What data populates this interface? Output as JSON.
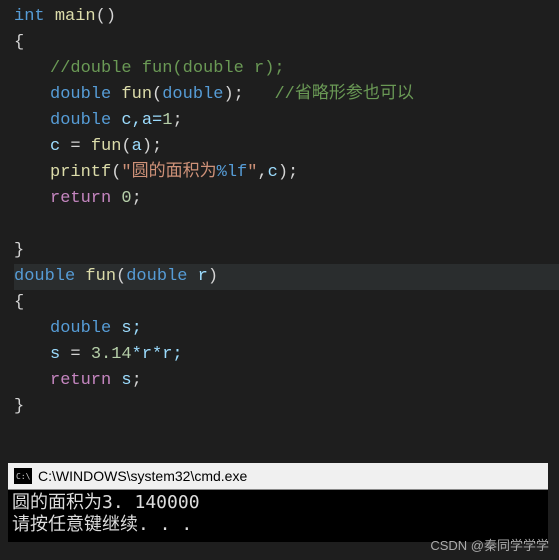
{
  "code": {
    "l1": {
      "type": "int",
      "fn": "main",
      "paren": "()"
    },
    "l2": {
      "brace": "{"
    },
    "l3": {
      "comment": "//double fun(double r);"
    },
    "l4": {
      "type": "double",
      "fn": "fun",
      "lp": "(",
      "ptype": "double",
      "rp": ");",
      "spc": "   ",
      "comment": "//省略形参也可以"
    },
    "l5": {
      "type": "double",
      "rest": " c,a=",
      "num": "1",
      "semi": ";"
    },
    "l6": {
      "lhs": "c",
      "eq": " = ",
      "fn": "fun",
      "lp": "(",
      "arg": "a",
      "rp": ");"
    },
    "l7": {
      "fn": "printf",
      "lp": "(",
      "str1": "\"圆的面积为",
      "fmt": "%lf",
      "str2": "\"",
      "comma": ",",
      "arg": "c",
      "rp": ");"
    },
    "l8": {
      "kw": "return",
      "sp": " ",
      "num": "0",
      "semi": ";"
    },
    "l9": "",
    "l10": {
      "brace": "}"
    },
    "l11": {
      "type": "double",
      "fn": "fun",
      "lp": "(",
      "ptype": "double",
      "param": " r",
      "rp": ")"
    },
    "l12": {
      "brace": "{"
    },
    "l13": {
      "type": "double",
      "rest": " s;"
    },
    "l14": {
      "lhs": "s",
      "eq": " = ",
      "n1": "3.14",
      "op": "*r*r;"
    },
    "l15": {
      "kw": "return",
      "sp": " ",
      "var": "s",
      "semi": ";"
    },
    "l16": {
      "brace": "}"
    }
  },
  "cmd": {
    "icon": "C:\\",
    "title": "C:\\WINDOWS\\system32\\cmd.exe",
    "out1": "圆的面积为3. 140000",
    "out2": "请按任意键继续. . . "
  },
  "watermark": "CSDN @秦同学学学"
}
